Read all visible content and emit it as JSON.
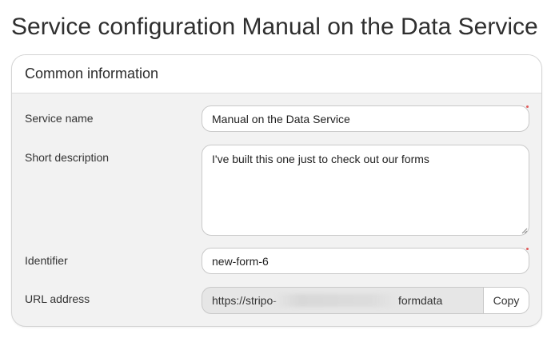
{
  "page": {
    "title": "Service configuration Manual on the Data Service"
  },
  "card": {
    "title": "Common information"
  },
  "form": {
    "service_name": {
      "label": "Service name",
      "value": "Manual on the Data Service",
      "required": true
    },
    "short_description": {
      "label": "Short description",
      "value": "I've built this one just to check out our forms"
    },
    "identifier": {
      "label": "Identifier",
      "value": "new-form-6",
      "required": true
    },
    "url_address": {
      "label": "URL address",
      "value_visible_start": "https://stripo-",
      "value_visible_end": "formdata",
      "value_obscured": true,
      "copy_label": "Copy"
    }
  },
  "colors": {
    "required_marker": "#e05a5a",
    "card_background": "#f2f2f2",
    "readonly_background": "#e6e6e6"
  }
}
